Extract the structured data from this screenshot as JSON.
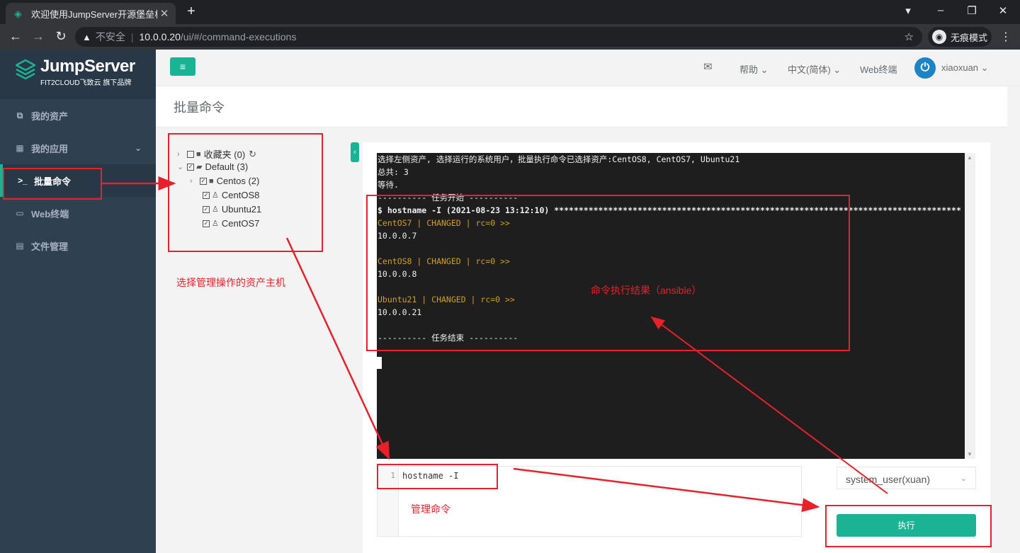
{
  "browser": {
    "tab_title": "欢迎使用JumpServer开源堡垒机",
    "security_label": "不安全",
    "url_host": "10.0.0.20",
    "url_path": "/ui/#/command-executions",
    "incognito_label": "无痕模式"
  },
  "sidebar": {
    "logo_title": "JumpServer",
    "logo_subtitle": "FIT2CLOUD飞致云 旗下品牌",
    "items": [
      {
        "label": "我的资产",
        "icon": "assets-icon"
      },
      {
        "label": "我的应用",
        "icon": "grid-icon"
      },
      {
        "label": "批量命令",
        "icon": "terminal-prompt-icon",
        "active": true
      },
      {
        "label": "Web终端",
        "icon": "window-icon"
      },
      {
        "label": "文件管理",
        "icon": "file-icon"
      }
    ]
  },
  "topbar": {
    "help": "帮助",
    "language": "中文(简体)",
    "web_terminal": "Web终端",
    "username": "xiaoxuan"
  },
  "page_title": "批量命令",
  "tree": {
    "favorites": "收藏夹 (0)",
    "default": "Default (3)",
    "centos_group": "Centos (2)",
    "nodes": [
      "CentOS8",
      "Ubuntu21",
      "CentOS7"
    ]
  },
  "terminal": {
    "lines": [
      {
        "text": "选择左侧资产, 选择运行的系统用户，批量执行命令已选择资产:CentOS8, CentOS7, Ubuntu21",
        "kind": "plain"
      },
      {
        "text": "总共: 3",
        "kind": "plain"
      },
      {
        "text": "等待.",
        "kind": "plain"
      },
      {
        "text": "---------- 任务开始 ----------",
        "kind": "plain"
      },
      {
        "text": "$ hostname -I (2021-08-23 13:12:10) ***********************************************************************************",
        "kind": "bold"
      },
      {
        "text": "CentOS7 | CHANGED | rc=0 >>",
        "kind": "host"
      },
      {
        "text": "10.0.0.7",
        "kind": "plain"
      },
      {
        "text": "",
        "kind": "plain"
      },
      {
        "text": "CentOS8 | CHANGED | rc=0 >>",
        "kind": "host"
      },
      {
        "text": "10.0.0.8",
        "kind": "plain"
      },
      {
        "text": "",
        "kind": "plain"
      },
      {
        "text": "Ubuntu21 | CHANGED | rc=0 >>",
        "kind": "host"
      },
      {
        "text": "10.0.0.21",
        "kind": "plain"
      },
      {
        "text": "",
        "kind": "plain"
      },
      {
        "text": "---------- 任务结束 ----------",
        "kind": "plain"
      }
    ]
  },
  "editor": {
    "line_number": "1",
    "command": "hostname -I"
  },
  "system_user": "system_user(xuan)",
  "run_button": "执行",
  "annotations": {
    "select_hosts": "选择管理操作的资产主机",
    "result": "命令执行结果（ansible）",
    "manage_cmd": "管理命令"
  },
  "colors": {
    "accent": "#1ab394",
    "sidebar": "#2f4050",
    "annotation": "#e8202a",
    "terminal_host": "#d0a020"
  }
}
